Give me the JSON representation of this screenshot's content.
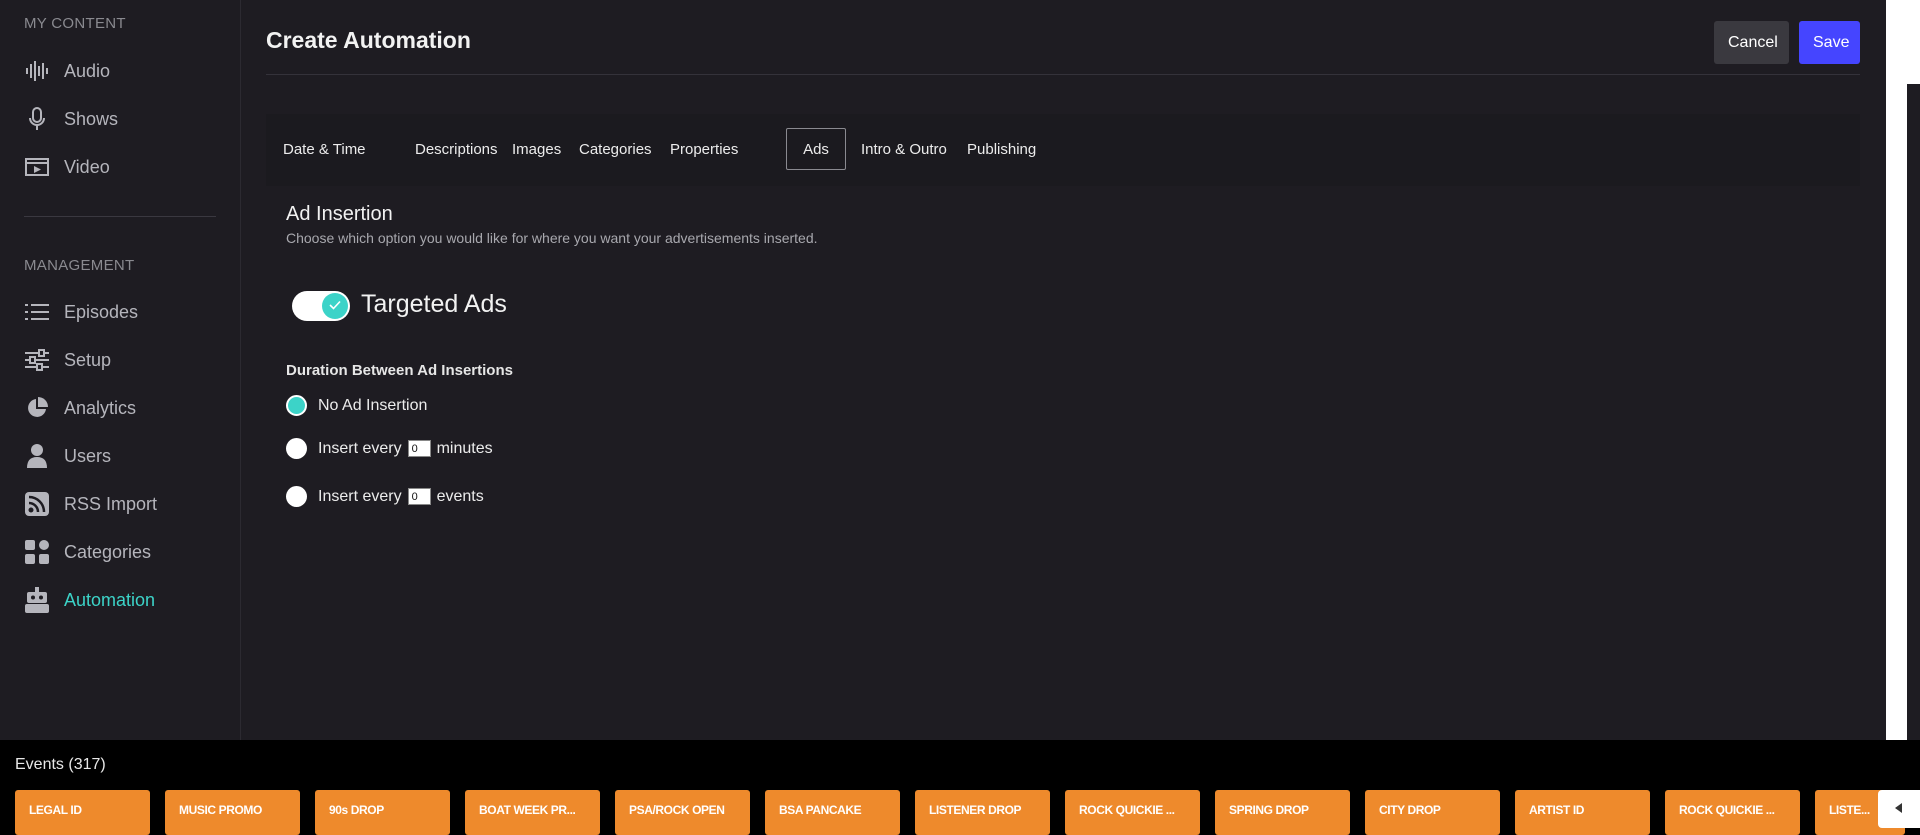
{
  "sidebar": {
    "my_content_label": "MY CONTENT",
    "management_label": "MANAGEMENT",
    "items": [
      {
        "label": "Audio",
        "icon": "waveform-icon"
      },
      {
        "label": "Shows",
        "icon": "microphone-icon"
      },
      {
        "label": "Video",
        "icon": "video-icon"
      },
      {
        "label": "Episodes",
        "icon": "list-icon"
      },
      {
        "label": "Setup",
        "icon": "sliders-icon"
      },
      {
        "label": "Analytics",
        "icon": "pie-chart-icon"
      },
      {
        "label": "Users",
        "icon": "user-icon"
      },
      {
        "label": "RSS Import",
        "icon": "rss-icon"
      },
      {
        "label": "Categories",
        "icon": "grid-icon"
      },
      {
        "label": "Automation",
        "icon": "robot-icon",
        "active": true
      }
    ]
  },
  "header": {
    "title": "Create Automation",
    "cancel_label": "Cancel",
    "save_label": "Save"
  },
  "tabs": [
    "Date & Time",
    "Descriptions",
    "Images",
    "Categories",
    "Properties",
    "Ads",
    "Intro & Outro",
    "Publishing"
  ],
  "active_tab": "Ads",
  "ad_insertion": {
    "title": "Ad Insertion",
    "description": "Choose which option you would like for where you want your advertisements inserted.",
    "toggle_label": "Targeted Ads",
    "toggle_on": true,
    "duration_label": "Duration Between Ad Insertions",
    "options": {
      "none_label": "No Ad Insertion",
      "insert_every_label": "Insert every",
      "minutes_unit": "minutes",
      "minutes_value": "0",
      "events_unit": "events",
      "events_value": "0"
    },
    "selected_option": "No Ad Insertion"
  },
  "events": {
    "title": "Events (317)",
    "cards": [
      "LEGAL ID",
      "MUSIC PROMO",
      "90s DROP",
      "BOAT WEEK PR...",
      "PSA/ROCK OPEN",
      "BSA PANCAKE",
      "LISTENER DROP",
      "ROCK QUICKIE ...",
      "SPRING DROP",
      "CITY DROP",
      "ARTIST ID",
      "ROCK QUICKIE ...",
      "LISTE..."
    ]
  },
  "colors": {
    "accent": "#3cd3c8",
    "save_button": "#4545ff",
    "event_card": "#ee8a2c",
    "background": "#1e1c22"
  }
}
